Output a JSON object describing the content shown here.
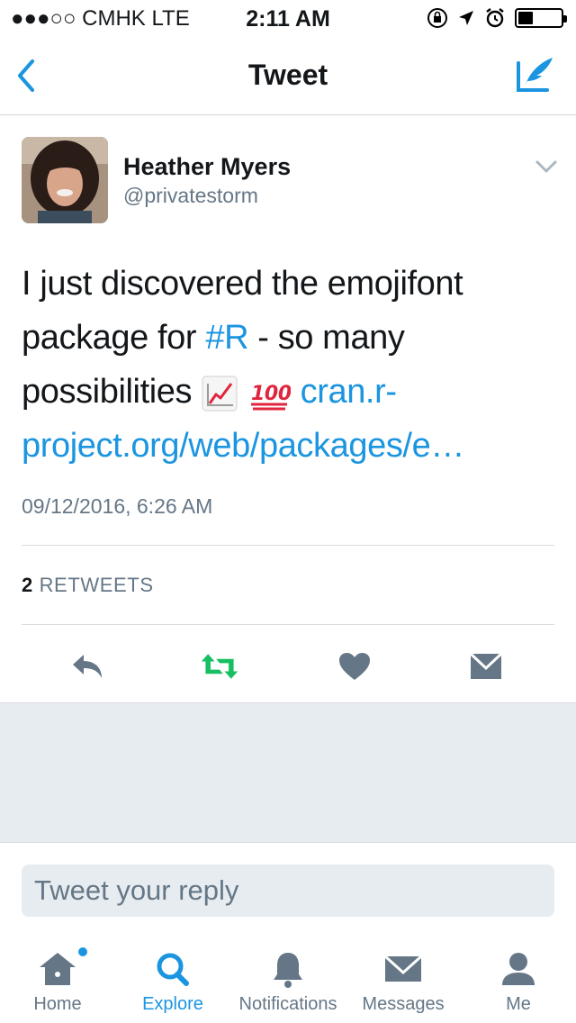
{
  "status_bar": {
    "carrier": "●●●○○ CMHK   LTE",
    "time": "2:11 AM"
  },
  "nav": {
    "title": "Tweet"
  },
  "tweet": {
    "author_name": "Heather Myers",
    "author_handle": "@privatestorm",
    "text_part1": "I just discovered the emojifont package for ",
    "hashtag": "#R",
    "text_part2": " - so many possibilities ",
    "link_text": "cran.r-project.org/web/packages/e…",
    "timestamp": "09/12/2016, 6:26 AM",
    "retweet_count": "2",
    "retweet_label": "RETWEETS",
    "emojis": [
      "chart-increasing",
      "hundred-points"
    ]
  },
  "reply": {
    "placeholder": "Tweet your reply"
  },
  "tabs": [
    {
      "label": "Home",
      "icon": "home-icon"
    },
    {
      "label": "Explore",
      "icon": "search-icon"
    },
    {
      "label": "Notifications",
      "icon": "bell-icon"
    },
    {
      "label": "Messages",
      "icon": "envelope-icon"
    },
    {
      "label": "Me",
      "icon": "person-icon"
    }
  ],
  "colors": {
    "accent": "#1b95e0",
    "retweet_green": "#17bf63",
    "icon_gray": "#657786",
    "background_gray": "#e6ecf0"
  }
}
